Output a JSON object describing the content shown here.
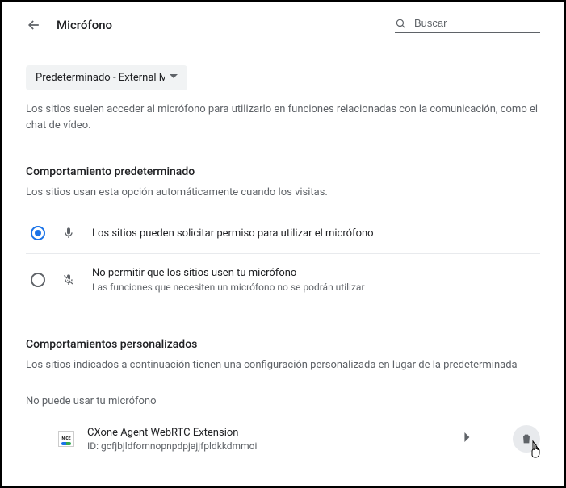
{
  "header": {
    "title": "Micrófono",
    "search_placeholder": "Buscar"
  },
  "device_dropdown": {
    "selected": "Predeterminado - External Mic"
  },
  "intro_desc": "Los sitios suelen acceder al micrófono para utilizarlo en funciones relacionadas con la comunicación, como el chat de vídeo.",
  "default_behavior": {
    "title": "Comportamiento predeterminado",
    "subtitle": "Los sitios usan esta opción automáticamente cuando los visitas.",
    "options": [
      {
        "label": "Los sitios pueden solicitar permiso para utilizar el micrófono",
        "sub": "",
        "checked": true,
        "icon": "mic"
      },
      {
        "label": "No permitir que los sitios usen tu micrófono",
        "sub": "Las funciones que necesiten un micrófono no se podrán utilizar",
        "checked": false,
        "icon": "mic-off"
      }
    ]
  },
  "custom_behavior": {
    "title": "Comportamientos personalizados",
    "desc": "Los sitios indicados a continuación tienen una configuración personalizada en lugar de la predeterminada",
    "blocked_label": "No puede usar tu micrófono",
    "sites": [
      {
        "name": "CXone Agent WebRTC Extension",
        "id": "ID: gcfjbjldfomnopnpdpjajjfpldkkdmmoi",
        "favicon_text": "NICE"
      }
    ]
  }
}
